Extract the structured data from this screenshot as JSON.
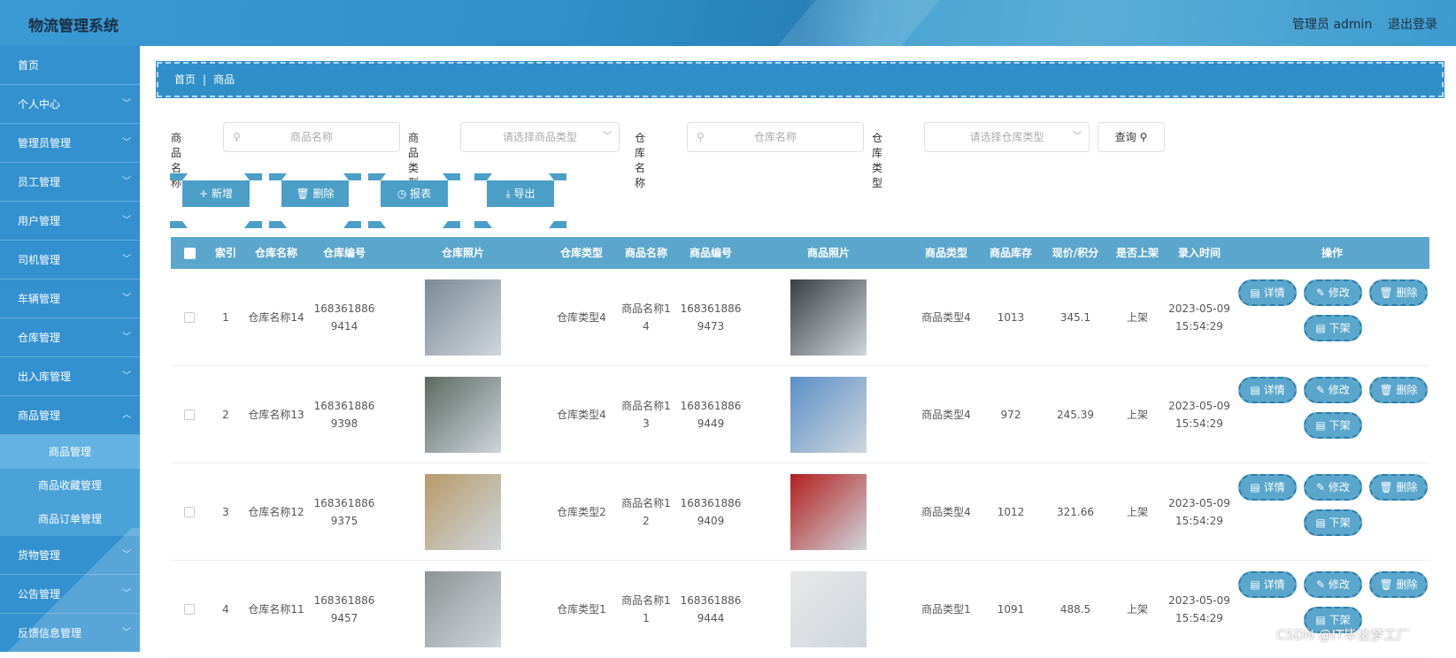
{
  "header": {
    "title": "物流管理系统",
    "user": "管理员 admin",
    "logout": "退出登录"
  },
  "sidebar": {
    "items": [
      {
        "label": "首页"
      },
      {
        "label": "个人中心"
      },
      {
        "label": "管理员管理"
      },
      {
        "label": "员工管理"
      },
      {
        "label": "用户管理"
      },
      {
        "label": "司机管理"
      },
      {
        "label": "车辆管理"
      },
      {
        "label": "仓库管理"
      },
      {
        "label": "出入库管理"
      },
      {
        "label": "商品管理"
      }
    ],
    "sub_items": [
      {
        "label": "商品管理"
      },
      {
        "label": "商品收藏管理"
      },
      {
        "label": "商品订单管理"
      }
    ],
    "items_after": [
      {
        "label": "货物管理"
      },
      {
        "label": "公告管理"
      },
      {
        "label": "反馈信息管理"
      }
    ]
  },
  "breadcrumb": {
    "home": "首页",
    "sep": "|",
    "current": "商品"
  },
  "search": {
    "goods_name_label": "商品名称",
    "goods_name_placeholder": "商品名称",
    "goods_type_label": "商品类型",
    "goods_type_placeholder": "请选择商品类型",
    "warehouse_name_label": "仓库名称",
    "warehouse_name_placeholder": "仓库名称",
    "warehouse_type_label": "仓库类型",
    "warehouse_type_placeholder": "请选择仓库类型",
    "query_label": "查询"
  },
  "actions": {
    "add": "新增",
    "delete": "删除",
    "report": "报表",
    "export": "导出"
  },
  "table": {
    "headers": [
      "索引",
      "仓库名称",
      "仓库编号",
      "仓库照片",
      "仓库类型",
      "商品名称",
      "商品编号",
      "商品照片",
      "商品类型",
      "商品库存",
      "现价/积分",
      "是否上架",
      "录入时间",
      "操作"
    ],
    "rows": [
      {
        "index": "1",
        "wh_name": "仓库名称14",
        "wh_no": "1683618869414",
        "wh_type": "仓库类型4",
        "goods_name": "商品名称14",
        "goods_no": "1683618869473",
        "goods_type": "商品类型4",
        "stock": "1013",
        "price": "345.1",
        "listed": "上架",
        "time": "2023-05-09 15:54:29"
      },
      {
        "index": "2",
        "wh_name": "仓库名称13",
        "wh_no": "1683618869398",
        "wh_type": "仓库类型4",
        "goods_name": "商品名称13",
        "goods_no": "1683618869449",
        "goods_type": "商品类型4",
        "stock": "972",
        "price": "245.39",
        "listed": "上架",
        "time": "2023-05-09 15:54:29"
      },
      {
        "index": "3",
        "wh_name": "仓库名称12",
        "wh_no": "1683618869375",
        "wh_type": "仓库类型2",
        "goods_name": "商品名称12",
        "goods_no": "1683618869409",
        "goods_type": "商品类型4",
        "stock": "1012",
        "price": "321.66",
        "listed": "上架",
        "time": "2023-05-09 15:54:29"
      },
      {
        "index": "4",
        "wh_name": "仓库名称11",
        "wh_no": "1683618869457",
        "wh_type": "仓库类型1",
        "goods_name": "商品名称11",
        "goods_no": "1683618869444",
        "goods_type": "商品类型1",
        "stock": "1091",
        "price": "488.5",
        "listed": "上架",
        "time": "2023-05-09 15:54:29"
      }
    ],
    "ops": {
      "detail": "详情",
      "edit": "修改",
      "delete": "删除",
      "unlist": "下架"
    }
  },
  "watermark": "CSDN @IT毕设梦工厂",
  "colors": {
    "primary": "#3391cf",
    "button": "#5aa6cc",
    "header_bg": "#2f8fc8"
  }
}
